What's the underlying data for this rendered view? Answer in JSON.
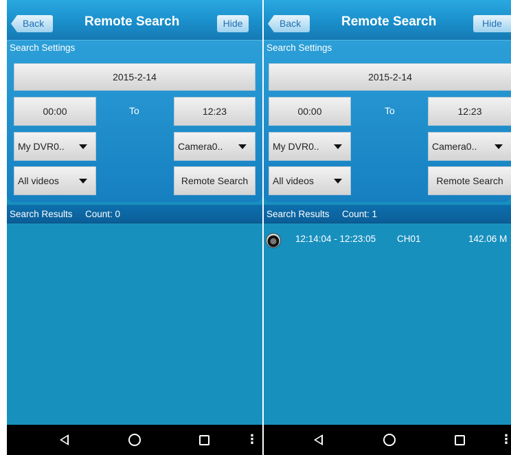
{
  "left": {
    "header": {
      "back_label": "Back",
      "title": "Remote Search",
      "hide_label": "Hide"
    },
    "settings": {
      "section_label": "Search Settings",
      "date": "2015-2-14",
      "start_time": "00:00",
      "to_label": "To",
      "end_time": "12:23",
      "dvr_select": "My DVR0..",
      "camera_select": "Camera0..",
      "video_type_select": "All videos",
      "search_button": "Remote Search"
    },
    "results": {
      "label": "Search Results",
      "count_text": "Count:  0",
      "items": []
    }
  },
  "right": {
    "header": {
      "back_label": "Back",
      "title": "Remote Search",
      "hide_label": "Hide"
    },
    "settings": {
      "section_label": "Search Settings",
      "date": "2015-2-14",
      "start_time": "00:00",
      "to_label": "To",
      "end_time": "12:23",
      "dvr_select": "My DVR0..",
      "camera_select": "Camera0..",
      "video_type_select": "All videos",
      "search_button": "Remote Search"
    },
    "results": {
      "label": "Search Results",
      "count_text": "Count:  1",
      "items": [
        {
          "time_range": "12:14:04 - 12:23:05",
          "channel": "CH01",
          "size": "142.06 M"
        }
      ]
    }
  },
  "icons": {
    "result_item": "camera-icon",
    "nav": [
      "back-icon",
      "home-icon",
      "recents-icon",
      "menu-icon"
    ]
  },
  "colors": {
    "background": "#1890be",
    "header": "#1a8fcb",
    "navbar": "#000000"
  }
}
